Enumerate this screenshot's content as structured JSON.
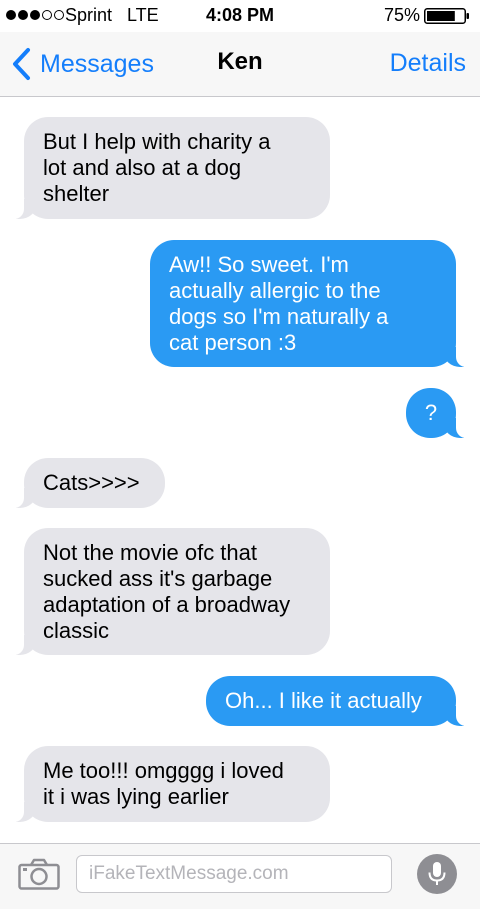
{
  "status_bar": {
    "carrier": "Sprint",
    "network": "LTE",
    "time": "4:08 PM",
    "battery": "75%",
    "signal_bars_filled": 3,
    "signal_bars_total": 5,
    "battery_level": 0.75
  },
  "nav": {
    "back_label": "Messages",
    "title": "Ken",
    "details_label": "Details"
  },
  "messages": [
    {
      "from": "incoming",
      "text": "But I help with charity a\nlot and also at a dog\nshelter"
    },
    {
      "from": "outgoing",
      "text": "Aw!! So sweet. I'm\nactually allergic to the\ndogs so I'm naturally a\ncat person :3"
    },
    {
      "from": "outgoing",
      "text": "?"
    },
    {
      "from": "incoming",
      "text": "Cats>>>>"
    },
    {
      "from": "incoming",
      "text": "Not the movie ofc that\nsucked ass it's garbage\nadaptation of a broadway\nclassic"
    },
    {
      "from": "outgoing",
      "text": "Oh... I like it actually"
    },
    {
      "from": "incoming",
      "text": "Me too!!! omgggg i loved\nit i was lying earlier"
    }
  ],
  "composer": {
    "placeholder": "iFakeTextMessage.com",
    "value": ""
  },
  "icons": [
    "chevron-left-icon",
    "camera-icon",
    "microphone-icon",
    "battery-icon"
  ],
  "colors": {
    "accent": "#147efb",
    "outgoing_bubble": "#2a9af3",
    "incoming_bubble": "#e5e5ea",
    "bar_background": "#f7f7f7"
  }
}
